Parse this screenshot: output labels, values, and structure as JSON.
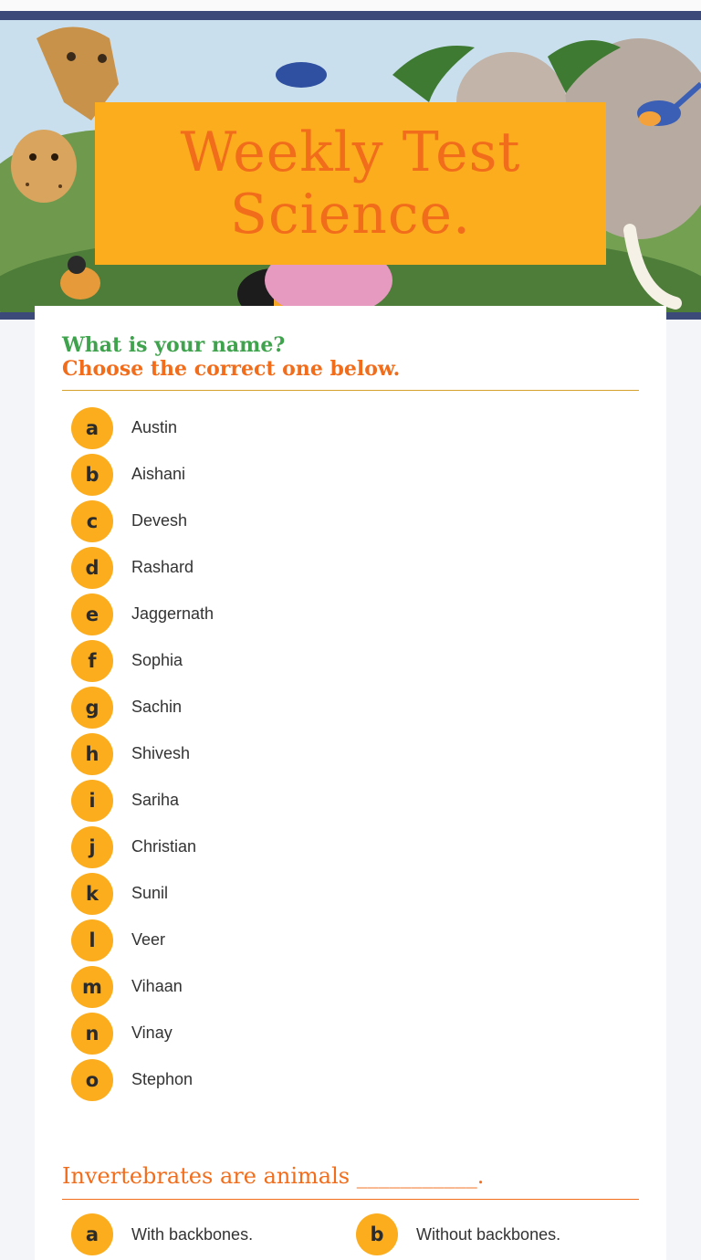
{
  "header": {
    "title_line_1": "Weekly Test",
    "title_line_2": "Science."
  },
  "question_1": {
    "prompt_line_1": "What is your name?",
    "prompt_line_2": "Choose the correct one below.",
    "options": [
      {
        "letter": "a",
        "label": "Austin"
      },
      {
        "letter": "b",
        "label": "Aishani"
      },
      {
        "letter": "c",
        "label": "Devesh"
      },
      {
        "letter": "d",
        "label": "Rashard"
      },
      {
        "letter": "e",
        "label": "Jaggernath"
      },
      {
        "letter": "f",
        "label": "Sophia"
      },
      {
        "letter": "g",
        "label": "Sachin"
      },
      {
        "letter": "h",
        "label": "Shivesh"
      },
      {
        "letter": "i",
        "label": "Sariha"
      },
      {
        "letter": "j",
        "label": "Christian"
      },
      {
        "letter": "k",
        "label": "Sunil"
      },
      {
        "letter": "l",
        "label": "Veer"
      },
      {
        "letter": "m",
        "label": "Vihaan"
      },
      {
        "letter": "n",
        "label": "Vinay"
      },
      {
        "letter": "o",
        "label": "Stephon"
      }
    ]
  },
  "question_2": {
    "prompt": "Invertebrates are animals ___________.",
    "options": [
      {
        "letter": "a",
        "label": "With backbones."
      },
      {
        "letter": "b",
        "label": "Without backbones."
      }
    ]
  },
  "colors": {
    "accent_orange": "#f26d1b",
    "bubble_yellow": "#fbad1e",
    "heading_green": "#3fa34d",
    "border_navy": "#3b4a78"
  },
  "icons": {
    "banner_art": "jungle-animals-illustration"
  }
}
